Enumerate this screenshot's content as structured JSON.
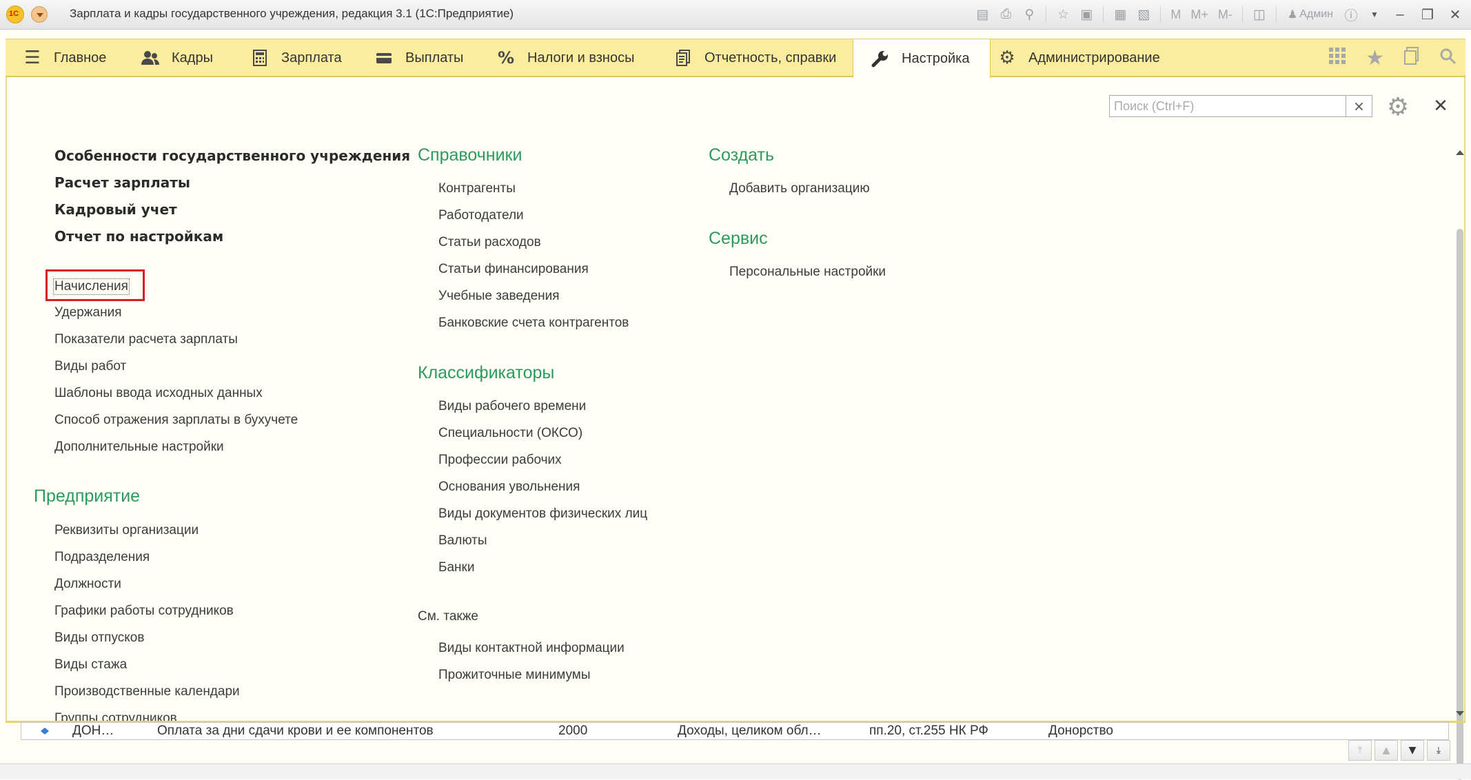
{
  "window": {
    "title": "Зарплата и кадры государственного учреждения, редакция 3.1  (1С:Предприятие)",
    "logo_text": "1С",
    "toolbar_text": [
      "M",
      "M+",
      "M-"
    ],
    "user": "Админ"
  },
  "sections": [
    {
      "label": "Главное",
      "icon": "menu-icon"
    },
    {
      "label": "Кадры",
      "icon": "people-icon"
    },
    {
      "label": "Зарплата",
      "icon": "calculator-icon"
    },
    {
      "label": "Выплаты",
      "icon": "wallet-icon"
    },
    {
      "label": "Налоги и взносы",
      "icon": "percent-icon"
    },
    {
      "label": "Отчетность, справки",
      "icon": "reports-icon"
    },
    {
      "label": "Настройка",
      "icon": "wrench-icon",
      "active": true
    },
    {
      "label": "Администрирование",
      "icon": "gear-icon"
    }
  ],
  "search": {
    "placeholder": "Поиск (Ctrl+F)",
    "value": ""
  },
  "col1": {
    "bold_links": [
      "Особенности государственного учреждения",
      "Расчет зарплаты",
      "Кадровый учет",
      "Отчет по настройкам"
    ],
    "links": [
      "Начисления",
      "Удержания",
      "Показатели расчета зарплаты",
      "Виды работ",
      "Шаблоны ввода исходных данных",
      "Способ отражения зарплаты в бухучете",
      "Дополнительные настройки"
    ],
    "enterprise": {
      "title": "Предприятие",
      "links": [
        "Реквизиты организации",
        "Подразделения",
        "Должности",
        "Графики работы сотрудников",
        "Виды отпусков",
        "Виды стажа",
        "Производственные календари",
        "Группы сотрудников"
      ]
    }
  },
  "col2": {
    "references": {
      "title": "Справочники",
      "links": [
        "Контрагенты",
        "Работодатели",
        "Статьи расходов",
        "Статьи финансирования",
        "Учебные заведения",
        "Банковские счета контрагентов"
      ]
    },
    "classifiers": {
      "title": "Классификаторы",
      "links": [
        "Виды рабочего времени",
        "Специальности (ОКСО)",
        "Профессии рабочих",
        "Основания увольнения",
        "Виды документов физических лиц",
        "Валюты",
        "Банки"
      ]
    },
    "see_also": {
      "title": "См. также",
      "links": [
        "Виды контактной информации",
        "Прожиточные минимумы"
      ]
    }
  },
  "col3": {
    "create": {
      "title": "Создать",
      "links": [
        "Добавить организацию"
      ]
    },
    "service": {
      "title": "Сервис",
      "links": [
        "Персональные настройки"
      ]
    }
  },
  "table_row": {
    "code": "ДОН…",
    "name": "Оплата за дни сдачи крови и ее компонентов",
    "number": "2000",
    "tax": "Доходы, целиком обл…",
    "article": "пп.20, ст.255 НК РФ",
    "category": "Донорство"
  },
  "colors": {
    "section_bar": "#fbec9e",
    "group_heading": "#2d9a5d",
    "highlight": "#d81e1e"
  }
}
